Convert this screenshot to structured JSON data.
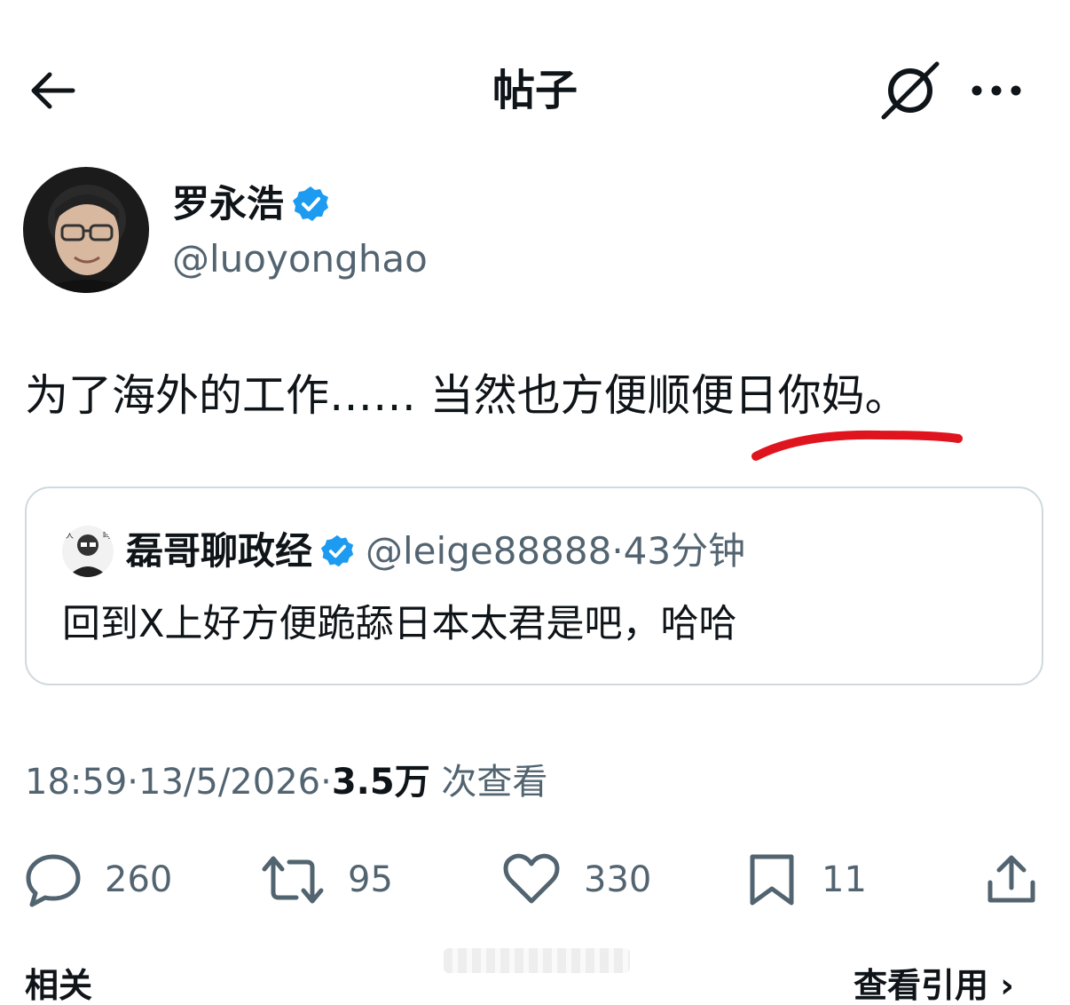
{
  "header": {
    "title": "帖子",
    "back_icon": "arrow-left-icon",
    "grok_icon": "grok-icon",
    "more_icon": "more-horizontal-icon"
  },
  "author": {
    "name": "罗永浩",
    "handle": "@luoyonghao",
    "verified": true
  },
  "tweet": {
    "text_part1": "为了海外的工作…… 当然也方便顺便",
    "text_part2": "日你妈。"
  },
  "quote": {
    "name": "磊哥聊政经",
    "handle": "@leige88888",
    "separator": "·",
    "time": "43分钟",
    "text": "回到X上好方便跪舔日本太君是吧，哈哈",
    "verified": true
  },
  "meta": {
    "time": "18:59",
    "separator": "·",
    "date": "13/5/2026",
    "views_count": "3.5万",
    "views_label": "次查看"
  },
  "actions": {
    "replies": "260",
    "reposts": "95",
    "likes": "330",
    "bookmarks": "11"
  },
  "bottom": {
    "left_label": "相关",
    "right_label": "查看引用 ›"
  },
  "colors": {
    "verified_blue": "#1d9bf0",
    "secondary_text": "#536471",
    "annotation_red": "#e0141e"
  }
}
